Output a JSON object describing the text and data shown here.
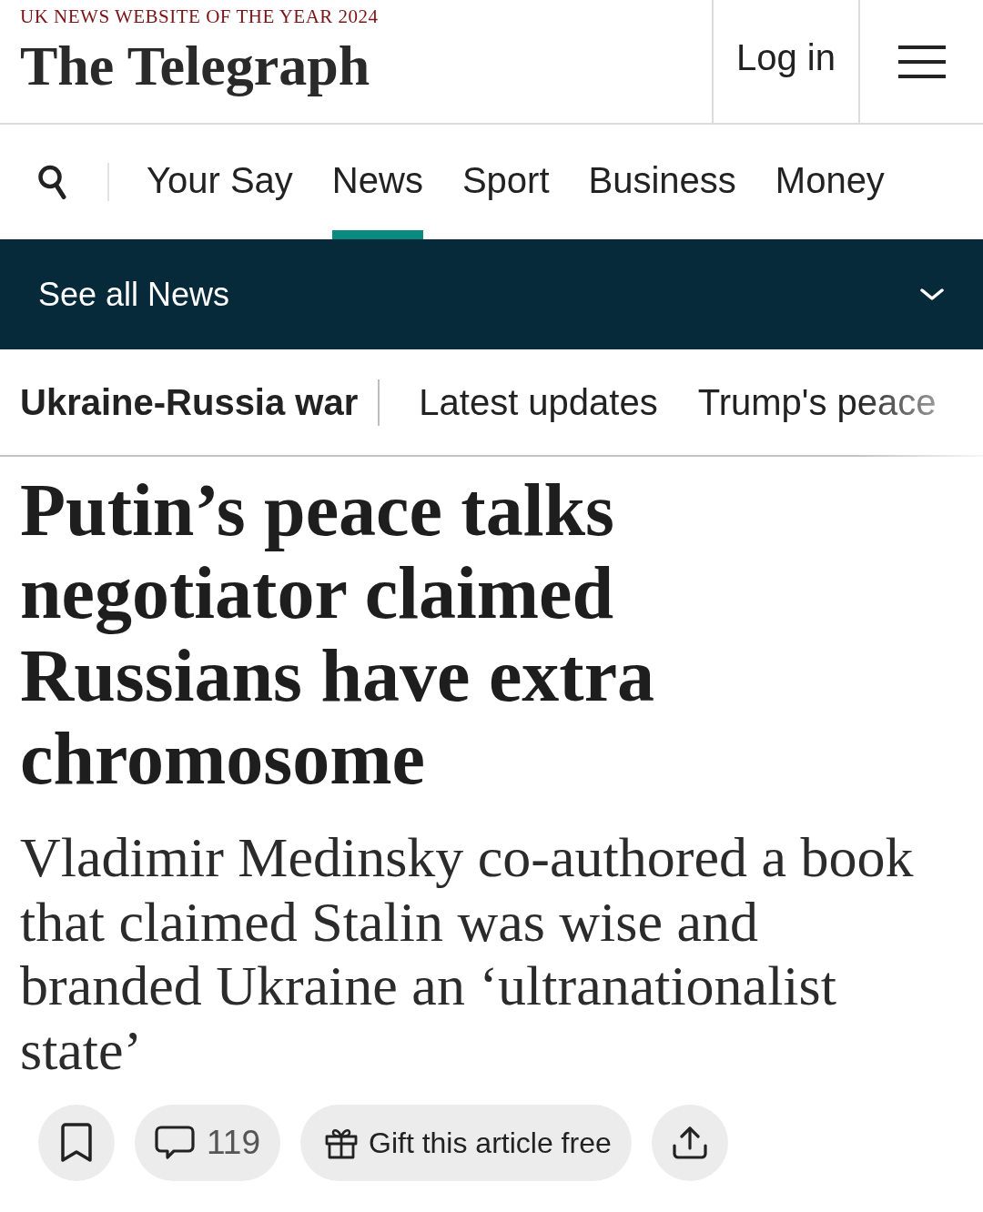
{
  "masthead": {
    "tagline": "UK NEWS WEBSITE OF THE YEAR 2024",
    "logo": "The Telegraph",
    "login": "Log in"
  },
  "nav": {
    "items": [
      {
        "label": "Your Say",
        "selected": false
      },
      {
        "label": "News",
        "selected": true
      },
      {
        "label": "Sport",
        "selected": false
      },
      {
        "label": "Business",
        "selected": false
      },
      {
        "label": "Money",
        "selected": false
      }
    ]
  },
  "section_bar": {
    "label": "See all News",
    "expanded": false
  },
  "topics": {
    "title": "Ukraine-Russia war",
    "items": [
      "Latest updates",
      "Trump's peace"
    ]
  },
  "article": {
    "headline": "Putin’s peace talks negotiator claimed Russians have extra chromosome",
    "standfirst": "Vladimir Medinsky co-authored a book that claimed Stalin was wise and branded Ukraine an ‘ultranationalist state’"
  },
  "actions": [
    {
      "kind": "bookmark"
    },
    {
      "kind": "comments",
      "count": "119"
    },
    {
      "kind": "gift",
      "label": "Gift this article free"
    },
    {
      "kind": "share"
    }
  ]
}
